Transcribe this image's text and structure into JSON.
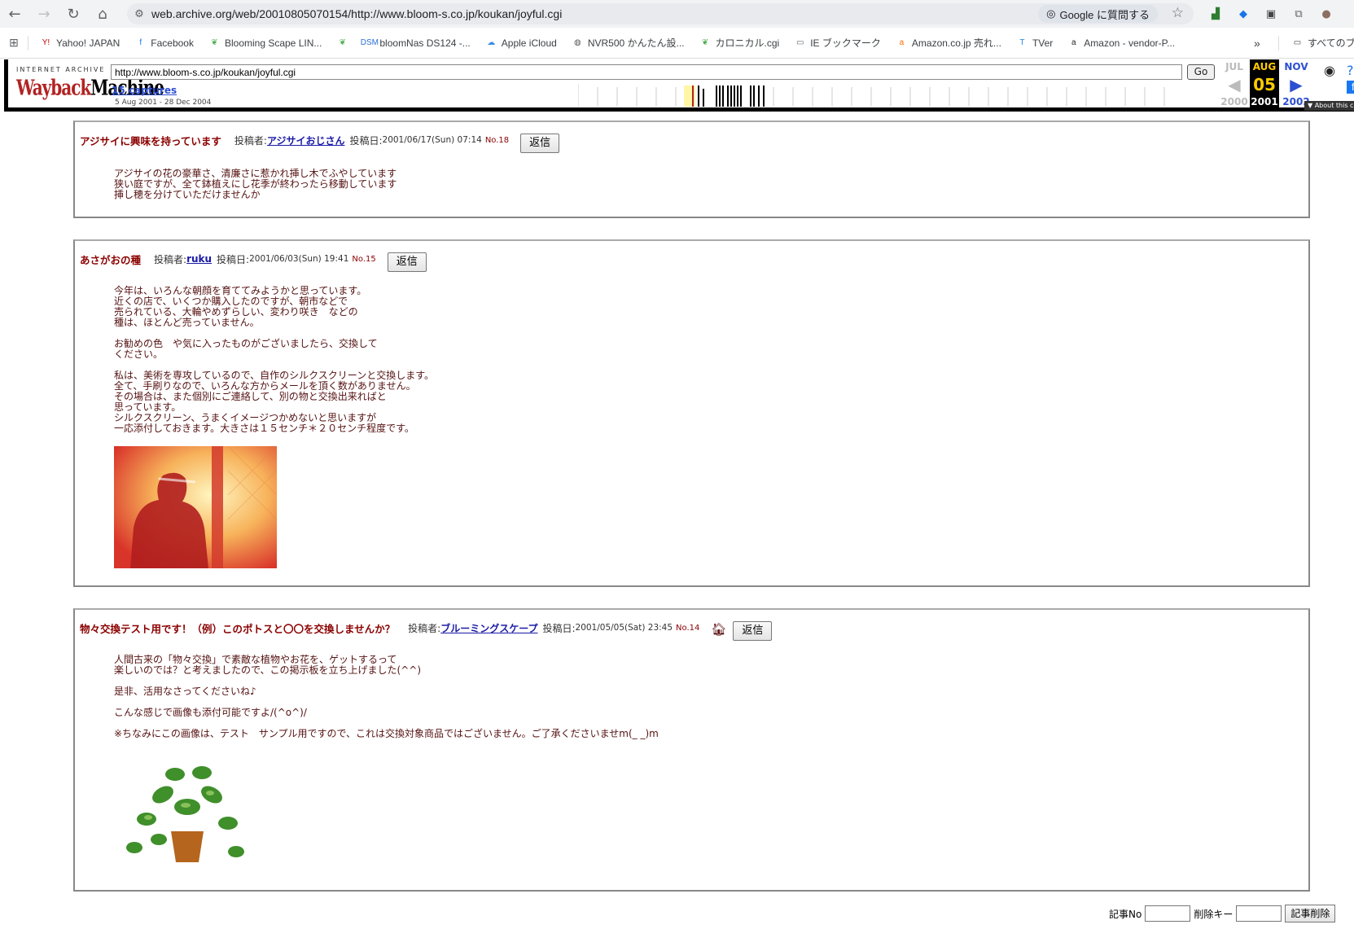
{
  "browser": {
    "url": "web.archive.org/web/20010805070154/http://www.bloom-s.co.jp/koukan/joyful.cgi",
    "google_ask_label": "Google に質問する"
  },
  "bookmarks": [
    {
      "label": "Yahoo! JAPAN",
      "icon": "yahoo-icon",
      "color": "#cc0000"
    },
    {
      "label": "Facebook",
      "icon": "facebook-icon",
      "color": "#1877f2"
    },
    {
      "label": "Blooming Scape LIN...",
      "icon": "leaf-icon",
      "color": "#4caf50"
    },
    {
      "label": "",
      "icon": "leaf-icon",
      "color": "#4caf50"
    },
    {
      "label": "bloomNas DS124 -...",
      "icon": "dsm-icon",
      "color": "#2a6fd6"
    },
    {
      "label": "Apple iCloud",
      "icon": "cloud-icon",
      "color": "#3a8ee6"
    },
    {
      "label": "NVR500 かんたん設...",
      "icon": "globe-icon",
      "color": "#555555"
    },
    {
      "label": "カロニカル.cgi",
      "icon": "leaf-icon",
      "color": "#4caf50"
    },
    {
      "label": "IE ブックマーク",
      "icon": "folder-icon",
      "color": "#5f6368"
    },
    {
      "label": "Amazon.co.jp 売れ...",
      "icon": "amazon-icon",
      "color": "#ff6a00"
    },
    {
      "label": "TVer",
      "icon": "tver-icon",
      "color": "#1e88e5"
    },
    {
      "label": "Amazon - vendor-P...",
      "icon": "amazon-a-icon",
      "color": "#222222"
    }
  ],
  "bookmarks_all_label": "すべてのブ",
  "wayback": {
    "ia_label": "INTERNET ARCHIVE",
    "logo_text_a": "Wayback",
    "logo_text_b": "Machine",
    "url_value": "http://www.bloom-s.co.jp/koukan/joyful.cgi",
    "go_label": "Go",
    "captures_label": "15 captures",
    "range_label": "5 Aug 2001 - 28 Dec 2004",
    "cal_prev_month": "JUL",
    "cal_prev_year": "2000",
    "cal_cur_month": "AUG",
    "cal_cur_day": "05",
    "cal_cur_year": "2001",
    "cal_next_month": "NOV",
    "cal_next_year": "2002",
    "about_label": "▼ About this capture"
  },
  "posts": [
    {
      "title": "アジサイに興味を持っています",
      "author_label": "投稿者:",
      "author": "アジサイおじさん",
      "date_label": "投稿日:",
      "date": "2001/06/17(Sun) 07:14",
      "no": "No.18",
      "reply": "返信",
      "body": "アジサイの花の豪華さ、清廉さに惹かれ挿し木でふやしています\n狭い庭ですが、全て鉢植えにし花季が終わったら移動しています\n挿し穂を分けていただけませんか"
    },
    {
      "title": "あさがおの種",
      "author_label": "投稿者:",
      "author": "ruku",
      "date_label": "投稿日:",
      "date": "2001/06/03(Sun) 19:41",
      "no": "No.15",
      "reply": "返信",
      "body": "今年は、いろんな朝顔を育ててみようかと思っています。\n近くの店で、いくつか購入したのですが、朝市などで\n売られている、大輪やめずらしい、変わり咲き　などの\n種は、ほとんど売っていません。\n\nお勧めの色　や気に入ったものがございましたら、交換して\nください。\n\n私は、美術を専攻しているので、自作のシルクスクリーンと交換します。\n全て、手刷りなので、いろんな方からメールを頂く数がありません。\nその場合は、また個別にご連絡して、別の物と交換出来ればと\n思っています。\nシルクスクリーン、うまくイメージつかめないと思いますが\n一応添付しておきます。大きさは１５センチ＊２０センチ程度です。"
    },
    {
      "title": "物々交換テスト用です！（例）このポトスと〇〇を交換しませんか？",
      "author_label": "投稿者:",
      "author": "ブルーミングスケープ",
      "date_label": "投稿日:",
      "date": "2001/05/05(Sat) 23:45",
      "no": "No.14",
      "reply": "返信",
      "body": "人間古来の「物々交換」で素敵な植物やお花を、ゲットするって\n楽しいのでは？と考えましたので、この掲示板を立ち上げました(^^)\n\n是非、活用なさってくださいね♪\n\nこんな感じで画像も添付可能ですよ/(^o^)/\n\n※ちなみにこの画像は、テスト　サンプル用ですので、これは交換対象商品ではございません。ご了承くださいませm(_ _)m"
    }
  ],
  "delete_form": {
    "no_label": "記事No",
    "key_label": "削除キー",
    "button": "記事削除"
  }
}
